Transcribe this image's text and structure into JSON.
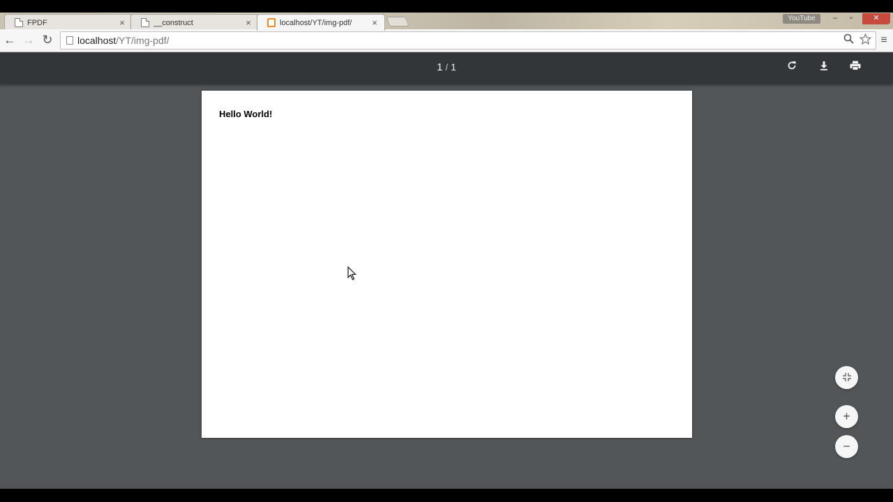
{
  "browser": {
    "tabs": [
      {
        "title": "FPDF",
        "close": "×"
      },
      {
        "title": "__construct",
        "close": "×"
      },
      {
        "title": "localhost/YT/img-pdf/",
        "close": "×"
      }
    ],
    "profile_badge": "YouTube",
    "window_controls": {
      "minimize": "–",
      "maximize": "▫",
      "close": "✕"
    },
    "nav": {
      "back": "←",
      "forward": "→",
      "reload": "↻"
    },
    "address": {
      "host": "localhost",
      "path": "/YT/img-pdf/"
    },
    "menu_icon": "≡"
  },
  "pdf_viewer": {
    "current_page": "1",
    "separator": "/",
    "total_pages": "1",
    "toolbar_icons": [
      "rotate-icon",
      "download-icon",
      "print-icon"
    ],
    "page_text": "Hello World!",
    "zoom_buttons": {
      "fit": "⤡",
      "zoom_in": "+",
      "zoom_out": "−"
    }
  },
  "colors": {
    "viewer_background": "#525659",
    "viewer_toolbar": "#323639",
    "pdf_tab_favicon": "#f08a24"
  }
}
